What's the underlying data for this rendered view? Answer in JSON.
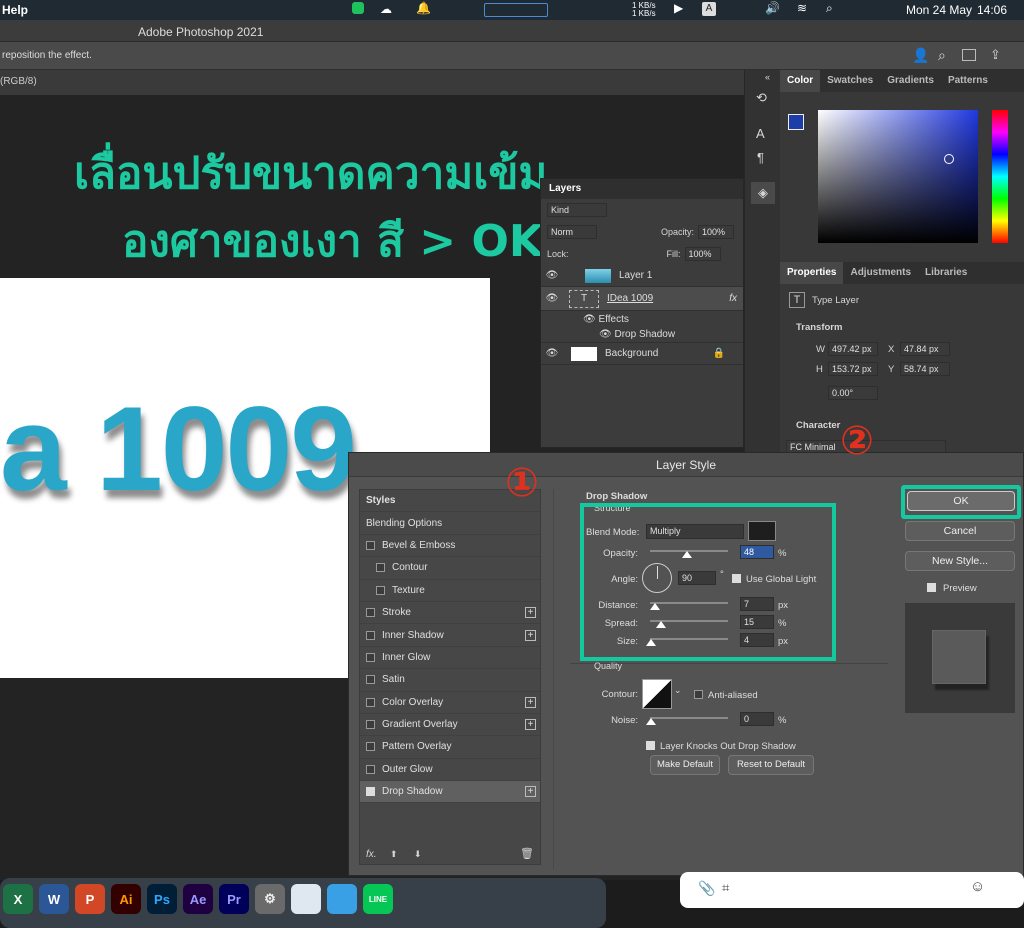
{
  "menubar": {
    "left_item": "Help",
    "kb_up": "1 KB/s",
    "kb_down": "1 KB/s",
    "date": "Mon 24 May",
    "time": "14:06"
  },
  "window": {
    "title": "Adobe Photoshop 2021"
  },
  "options_bar": {
    "hint": "reposition the effect."
  },
  "document": {
    "tab_suffix": "(RGB/8)",
    "overlay_line1": "เลื่อนปรับขนาดความเข้ม",
    "overlay_line2": "องศาของเงา สี > OK",
    "canvas_text": "a 1009"
  },
  "color_panel": {
    "tabs": [
      "Color",
      "Swatches",
      "Gradients",
      "Patterns"
    ],
    "fg_color": "#1d3ea8",
    "bg_color": "#ffffff"
  },
  "layers_panel": {
    "title": "Layers",
    "kind_label": "Kind",
    "blend_label": "Norm",
    "opacity_label": "Opacity:",
    "opacity_value": "100%",
    "lock_label": "Lock:",
    "fill_label": "Fill:",
    "fill_value": "100%",
    "layers": [
      {
        "name": "Layer 1"
      },
      {
        "name": "IDea 1009",
        "fx": "fx"
      },
      {
        "name": "Effects"
      },
      {
        "name": "Drop Shadow"
      },
      {
        "name": "Background"
      }
    ]
  },
  "properties_panel": {
    "tabs": [
      "Properties",
      "Adjustments",
      "Libraries"
    ],
    "type_label": "Type Layer",
    "transform_label": "Transform",
    "w_label": "W",
    "w": "497.42 px",
    "x_label": "X",
    "x": "47.84 px",
    "h_label": "H",
    "h": "153.72 px",
    "y_label": "Y",
    "y": "58.74 px",
    "angle": "0.00°",
    "character_label": "Character",
    "font": "FC Minimal"
  },
  "dialog": {
    "title": "Layer Style",
    "styles_header": "Styles",
    "blending_options": "Blending Options",
    "styles": [
      {
        "label": "Bevel & Emboss",
        "plus": false,
        "indent": false
      },
      {
        "label": "Contour",
        "plus": false,
        "indent": true
      },
      {
        "label": "Texture",
        "plus": false,
        "indent": true
      },
      {
        "label": "Stroke",
        "plus": true,
        "indent": false
      },
      {
        "label": "Inner Shadow",
        "plus": true,
        "indent": false
      },
      {
        "label": "Inner Glow",
        "plus": false,
        "indent": false
      },
      {
        "label": "Satin",
        "plus": false,
        "indent": false
      },
      {
        "label": "Color Overlay",
        "plus": true,
        "indent": false
      },
      {
        "label": "Gradient Overlay",
        "plus": true,
        "indent": false
      },
      {
        "label": "Pattern Overlay",
        "plus": false,
        "indent": false
      },
      {
        "label": "Outer Glow",
        "plus": false,
        "indent": false
      },
      {
        "label": "Drop Shadow",
        "plus": true,
        "indent": false,
        "checked": true
      }
    ],
    "section_title": "Drop Shadow",
    "structure_label": "Structure",
    "blend_mode_label": "Blend Mode:",
    "blend_mode": "Multiply",
    "opacity_label": "Opacity:",
    "opacity": "48",
    "pct": "%",
    "angle_label": "Angle:",
    "angle": "90",
    "deg": "°",
    "use_global_light": "Use Global Light",
    "distance_label": "Distance:",
    "distance": "7",
    "px": "px",
    "spread_label": "Spread:",
    "spread": "15",
    "size_label": "Size:",
    "size": "4",
    "quality_label": "Quality",
    "contour_label": "Contour:",
    "anti_aliased": "Anti-aliased",
    "noise_label": "Noise:",
    "noise": "0",
    "knocks_out": "Layer Knocks Out Drop Shadow",
    "make_default": "Make Default",
    "reset_default": "Reset to Default",
    "ok": "OK",
    "cancel": "Cancel",
    "new_style": "New Style...",
    "preview": "Preview",
    "shadow_color": "#1e1e1e"
  },
  "annotations": {
    "step1": "①",
    "step2": "②",
    "accent": "#14c8a0",
    "red": "#e0301e"
  },
  "dock": {
    "apps": [
      "X",
      "W",
      "P",
      "Ai",
      "Ps",
      "Ae",
      "Pr",
      "⚙",
      "",
      "",
      "LINE"
    ]
  }
}
